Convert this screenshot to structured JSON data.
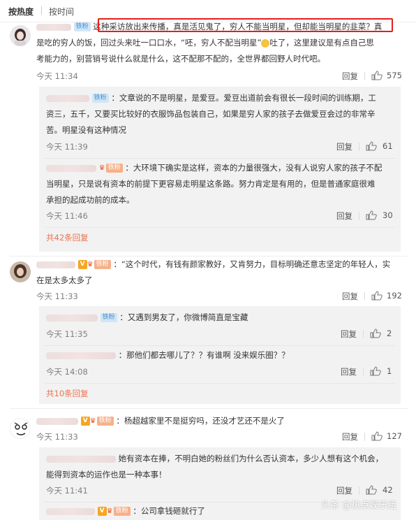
{
  "sort": {
    "hot": "按热度",
    "time": "按时间"
  },
  "badges": {
    "tie_fan": "铁粉",
    "v": "V"
  },
  "comments": [
    {
      "line1": "这种采访放出来传播，真是活见鬼了，穷人不能当明星，但却能当明星的韭菜？真",
      "line2": "是吃的穷人的饭，回过头来吐一口口水，“呸，穷人不配当明星”",
      "line2b": "吐了，这里建议是有点自己思",
      "line3": "考能力的，别营销号说什么就是什么，这不配那不配的，全世界都回野人时代吧。",
      "time": "今天 11:34",
      "reply": "回复",
      "likes": "575",
      "subs": [
        {
          "line1": "：文章说的不是明星，是爱豆。爱豆出道前会有很长一段时间的训练期，工",
          "line2": "资三，五千，又要买比较好的衣服饰品包装自己，如果是穷人家的孩子去做爱豆会过的非常辛",
          "line3": "苦。明星没有这种情况",
          "time": "今天 11:39",
          "reply": "回复",
          "likes": "61"
        },
        {
          "line1": "：大环境下确实是这样，资本的力量很强大，没有人说穷人家的孩子不配",
          "line2": "当明星，只是说有资本的前提下更容易走明星这条路。努力肯定是有用的，但是普通家庭很难",
          "line3": "承担的起成功前的成本。",
          "time": "今天 11:46",
          "reply": "回复",
          "likes": "30"
        }
      ],
      "more": "共42条回复"
    },
    {
      "line1": "：“这个时代，有钱有颜家教好，又肯努力，目标明确还意志坚定的年轻人，实",
      "line2": "在是太多太多了",
      "time": "今天 11:33",
      "reply": "回复",
      "likes": "192",
      "subs": [
        {
          "line1": "：又遇到男友了，你微博简直是宝藏",
          "time": "今天 11:35",
          "reply": "回复",
          "likes": "2"
        },
        {
          "line1": "：那他们都去哪儿了？？有谁啊 没来娱乐圈？？",
          "time": "今天 14:08",
          "reply": "回复",
          "likes": "1"
        }
      ],
      "more": "共10条回复"
    },
    {
      "line1": "：杨超越家里不是挺穷吗，还没才艺还不是火了",
      "time": "今天 11:33",
      "reply": "回复",
      "likes": "127",
      "subs": [
        {
          "line1": "她有资本在捧，不明白她的粉丝们为什么否认资本，多少人想有这个机会，",
          "line2": "能得到资本的运作也是一种本事！",
          "time": "今天 11:41",
          "reply": "回复",
          "likes": "42"
        },
        {
          "line1": "：公司拿钱砸就行了"
        }
      ]
    }
  ],
  "watermark": "头条 @热点娱乐组"
}
